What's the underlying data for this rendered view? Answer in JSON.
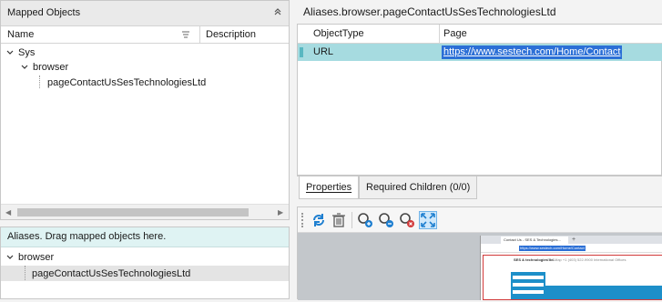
{
  "mapped_objects": {
    "title": "Mapped Objects",
    "columns": {
      "name": "Name",
      "description": "Description"
    },
    "tree": [
      {
        "label": "Sys",
        "level": 0,
        "expanded": true
      },
      {
        "label": "browser",
        "level": 1,
        "expanded": true
      },
      {
        "label": "pageContactUsSesTechnologiesLtd",
        "level": 2,
        "expanded": false
      }
    ]
  },
  "aliases": {
    "hint": "Aliases. Drag mapped objects here.",
    "tree": [
      {
        "label": "browser",
        "level": 0,
        "expanded": true
      },
      {
        "label": "pageContactUsSesTechnologiesLtd",
        "level": 1,
        "selected": true
      }
    ]
  },
  "details": {
    "title": "Aliases.browser.pageContactUsSesTechnologiesLtd",
    "columns": {
      "object_type": "ObjectType",
      "page": "Page"
    },
    "rows": [
      {
        "object_type": "URL",
        "page": "https://www.sestech.com/Home/Contact"
      }
    ]
  },
  "tabs": [
    {
      "label": "Properties",
      "active": true
    },
    {
      "label": "Required Children (0/0)",
      "active": false
    }
  ],
  "toolbar": {
    "buttons": [
      {
        "name": "refresh-icon"
      },
      {
        "name": "trash-icon"
      },
      {
        "name": "zoom-in-icon"
      },
      {
        "name": "zoom-out-icon"
      },
      {
        "name": "zoom-remove-icon"
      },
      {
        "name": "fit-screen-icon",
        "active": true
      }
    ]
  },
  "preview": {
    "tab_title": "Contact Us - SES & Technologies...",
    "url": "https://www.sestech.com/Home/Contact",
    "brand": "SES & technologies ltd.",
    "contact": "Site Map  +1 (403) 522-9900  International Offices"
  },
  "colors": {
    "selected_row": "#a6dbe0",
    "url_highlight": "#2b6fd6",
    "alias_header": "#dff3f3",
    "accent": "#1d8fc9"
  }
}
